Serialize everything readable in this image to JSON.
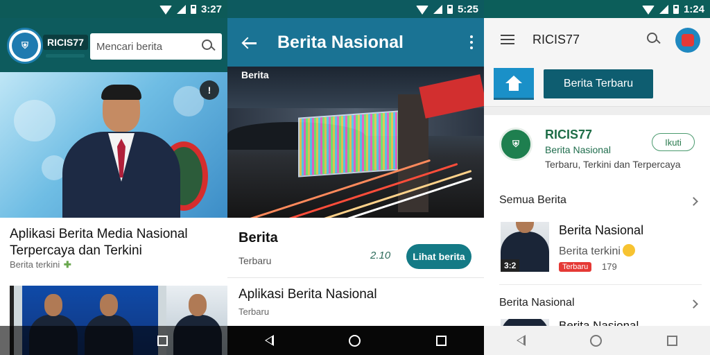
{
  "screen1": {
    "status_time": "3:27",
    "brand": "RICIS77",
    "search_placeholder": "Mencari berita",
    "hero_badge": "!",
    "article_title": "Aplikasi Berita Media Nasional Terpercaya dan Terkini",
    "article_meta": "Berita terkini",
    "article_meta_icon": "✚"
  },
  "screen2": {
    "status_time": "5:25",
    "title": "Berita Nasional",
    "hero_label": "Berita",
    "section_title": "Berita",
    "section_sub": "Terbaru",
    "count": "2.10",
    "button_label": "Lihat berita",
    "item_title": "Aplikasi Berita Nasional",
    "item_sub": "Terbaru"
  },
  "screen3": {
    "status_time": "1:24",
    "app_title": "RICIS77",
    "tab_button": "Berita Terbaru",
    "profile_name": "RICIS77",
    "profile_category": "Berita Nasional",
    "profile_desc": "Terbaru, Terkini dan Terpercaya",
    "follow_label": "Ikuti",
    "row1_label": "Semua Berita",
    "news_title": "Berita Nasional",
    "news_sub": "Berita terkini",
    "thumb_date": "3:2",
    "tag": "Terbaru",
    "views": "179",
    "row2_label": "Berita Nasional",
    "next_title": "Berita Nasional"
  },
  "colors": {
    "primary_teal": "#0d5b5d",
    "accent_blue": "#1a7394",
    "brand_green": "#1e7f4f"
  }
}
